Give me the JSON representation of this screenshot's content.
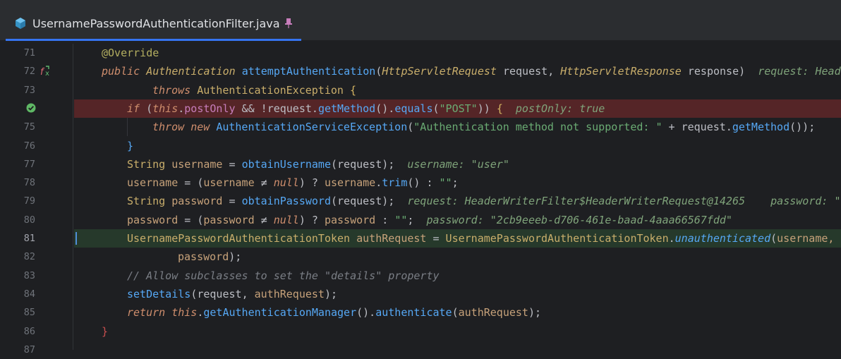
{
  "tab": {
    "title": "UsernamePasswordAuthenticationFilter.java",
    "accent": "#3574f0"
  },
  "icons": {
    "file": "java-class-icon",
    "pin": "pin-icon",
    "override_gutter": "override-method-icon",
    "breakpoint_gutter": "verified-breakpoint-icon"
  },
  "lines": [
    {
      "n": "71"
    },
    {
      "n": "72"
    },
    {
      "n": "73"
    },
    {
      "n": "74"
    },
    {
      "n": "75"
    },
    {
      "n": "76"
    },
    {
      "n": "77"
    },
    {
      "n": "78"
    },
    {
      "n": "79"
    },
    {
      "n": "80"
    },
    {
      "n": "81"
    },
    {
      "n": "82"
    },
    {
      "n": "83"
    },
    {
      "n": "84"
    },
    {
      "n": "85"
    },
    {
      "n": "86"
    },
    {
      "n": "87"
    }
  ],
  "code": {
    "l71": {
      "ann": "@Override"
    },
    "l72": {
      "kw": "public",
      "ty": "Authentication",
      "fn": "attemptAuthentication",
      "p1t": "HttpServletRequest",
      "p1": "request",
      "p2t": "HttpServletResponse",
      "p2": "response",
      "hint": "request: Heade"
    },
    "l73": {
      "kw": "throws",
      "ty": "AuthenticationException",
      "brace": "{"
    },
    "l74": {
      "kw": "if",
      "this": "this",
      "fd": "postOnly",
      "op": " && !",
      "var": "request",
      "fn1": "getMethod",
      "fn2": "equals",
      "str": "\"POST\"",
      "brace": "{",
      "hint": "postOnly: true"
    },
    "l75": {
      "kw1": "throw",
      "kw2": "new",
      "ty": "AuthenticationServiceException",
      "str": "\"Authentication method not supported: \"",
      "var": "request",
      "fn": "getMethod"
    },
    "l76": {
      "brace": "}"
    },
    "l77": {
      "ty": "String",
      "lv": "username",
      "fn": "obtainUsername",
      "var": "request",
      "hint": "username: \"user\""
    },
    "l78": {
      "lv": "username",
      "lv2": "username",
      "kw": "null",
      "lv3": "username",
      "fn": "trim",
      "str": "\"\""
    },
    "l79": {
      "ty": "String",
      "lv": "password",
      "fn": "obtainPassword",
      "var": "request",
      "hint": "request: HeaderWriterFilter$HeaderWriterRequest@14265",
      "hint2": "password: \""
    },
    "l80": {
      "lv": "password",
      "lv2": "password",
      "kw": "null",
      "lv3": "password",
      "str": "\"\"",
      "hint": "password: \"2cb9eeeb-d706-461e-baad-4aaa66567fdd\""
    },
    "l81": {
      "ty": "UsernamePasswordAuthenticationToken",
      "lv": "authRequest",
      "ty2": "UsernamePasswordAuthenticationToken",
      "fn": "unauthenticated",
      "lv2": "username,"
    },
    "l82": {
      "lv": "password"
    },
    "l83": {
      "cm": "// Allow subclasses to set the \"details\" property"
    },
    "l84": {
      "fn": "setDetails",
      "var": "request",
      "lv": "authRequest"
    },
    "l85": {
      "kw": "return",
      "this": "this",
      "fn1": "getAuthenticationManager",
      "fn2": "authenticate",
      "lv": "authRequest"
    },
    "l86": {
      "brace": "}"
    }
  }
}
